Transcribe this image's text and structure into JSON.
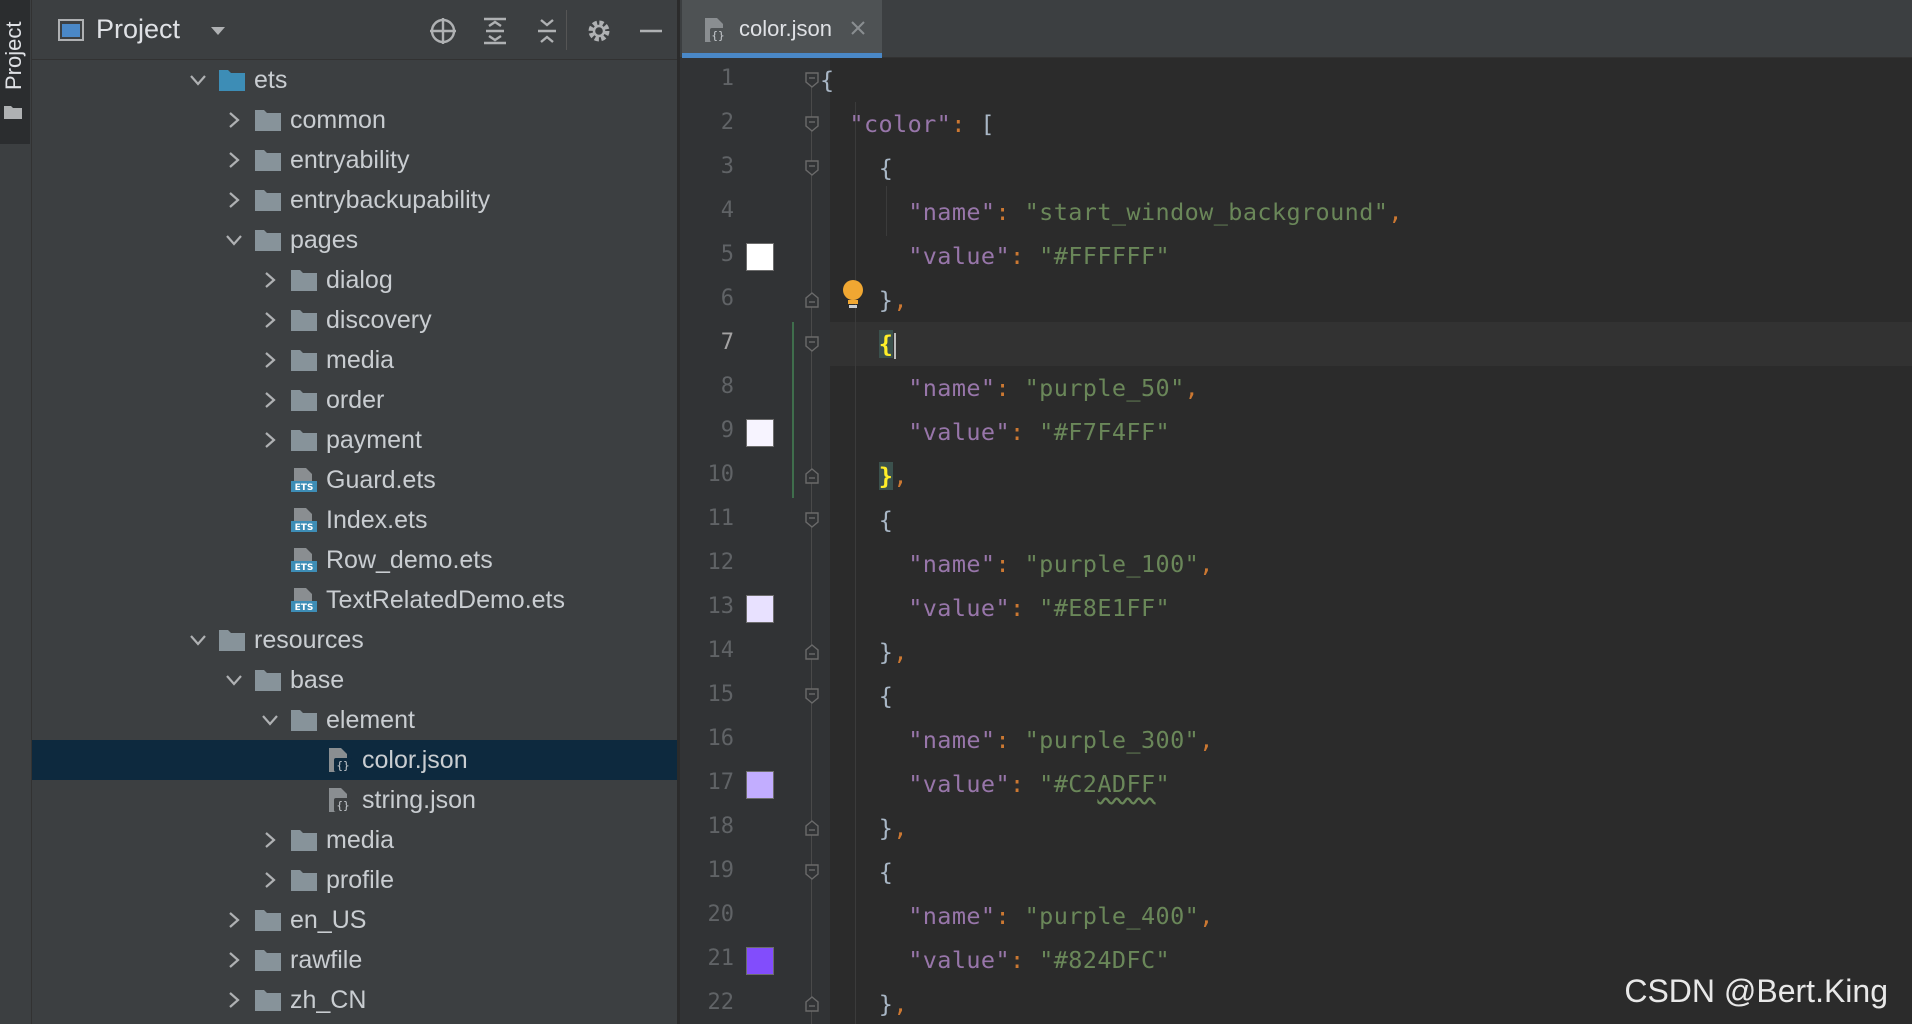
{
  "tool_stripe": {
    "project_label": "Project"
  },
  "panel": {
    "title": "Project",
    "header_icons": [
      "target-icon",
      "expand-all-icon",
      "collapse-all-icon",
      "gear-icon",
      "minimize-icon"
    ]
  },
  "tree": [
    {
      "label": "ets",
      "depth": 0,
      "expanded": true,
      "kind": "folder",
      "color": "#3d8db6"
    },
    {
      "label": "common",
      "depth": 1,
      "expanded": false,
      "kind": "folder"
    },
    {
      "label": "entryability",
      "depth": 1,
      "expanded": false,
      "kind": "folder"
    },
    {
      "label": "entrybackupability",
      "depth": 1,
      "expanded": false,
      "kind": "folder"
    },
    {
      "label": "pages",
      "depth": 1,
      "expanded": true,
      "kind": "folder"
    },
    {
      "label": "dialog",
      "depth": 2,
      "expanded": false,
      "kind": "folder"
    },
    {
      "label": "discovery",
      "depth": 2,
      "expanded": false,
      "kind": "folder"
    },
    {
      "label": "media",
      "depth": 2,
      "expanded": false,
      "kind": "folder"
    },
    {
      "label": "order",
      "depth": 2,
      "expanded": false,
      "kind": "folder"
    },
    {
      "label": "payment",
      "depth": 2,
      "expanded": false,
      "kind": "folder"
    },
    {
      "label": "Guard.ets",
      "depth": 2,
      "kind": "ets"
    },
    {
      "label": "Index.ets",
      "depth": 2,
      "kind": "ets"
    },
    {
      "label": "Row_demo.ets",
      "depth": 2,
      "kind": "ets"
    },
    {
      "label": "TextRelatedDemo.ets",
      "depth": 2,
      "kind": "ets"
    },
    {
      "label": "resources",
      "depth": 0,
      "expanded": true,
      "kind": "folder"
    },
    {
      "label": "base",
      "depth": 1,
      "expanded": true,
      "kind": "folder"
    },
    {
      "label": "element",
      "depth": 2,
      "expanded": true,
      "kind": "folder"
    },
    {
      "label": "color.json",
      "depth": 3,
      "kind": "json",
      "selected": true
    },
    {
      "label": "string.json",
      "depth": 3,
      "kind": "json"
    },
    {
      "label": "media",
      "depth": 2,
      "expanded": false,
      "kind": "folder"
    },
    {
      "label": "profile",
      "depth": 2,
      "expanded": false,
      "kind": "folder"
    },
    {
      "label": "en_US",
      "depth": 1,
      "expanded": false,
      "kind": "folder"
    },
    {
      "label": "rawfile",
      "depth": 1,
      "expanded": false,
      "kind": "folder"
    },
    {
      "label": "zh_CN",
      "depth": 1,
      "expanded": false,
      "kind": "folder"
    }
  ],
  "editor": {
    "tab": {
      "label": "color.json",
      "active": true
    },
    "current_line": 7,
    "lines": [
      {
        "n": "1"
      },
      {
        "n": "2"
      },
      {
        "n": "3"
      },
      {
        "n": "4"
      },
      {
        "n": "5",
        "swatch": "#FFFFFF"
      },
      {
        "n": "6"
      },
      {
        "n": "7"
      },
      {
        "n": "8"
      },
      {
        "n": "9",
        "swatch": "#F7F4FF"
      },
      {
        "n": "10"
      },
      {
        "n": "11"
      },
      {
        "n": "12"
      },
      {
        "n": "13",
        "swatch": "#E8E1FF"
      },
      {
        "n": "14"
      },
      {
        "n": "15"
      },
      {
        "n": "16"
      },
      {
        "n": "17",
        "swatch": "#C2ADFF"
      },
      {
        "n": "18"
      },
      {
        "n": "19"
      },
      {
        "n": "20"
      },
      {
        "n": "21",
        "swatch": "#824DFC"
      },
      {
        "n": "22"
      }
    ],
    "code": {
      "key_color": "color",
      "key_name": "name",
      "key_value": "value",
      "names": [
        "start_window_background",
        "purple_50",
        "purple_100",
        "purple_300",
        "purple_400"
      ],
      "values": [
        "#FFFFFF",
        "#F7F4FF",
        "#E8E1FF",
        "#C2ADFF",
        "#824DFC"
      ]
    }
  },
  "colors": {
    "key": "#9876aa",
    "string": "#6a8759",
    "punct": "#a9b7c6",
    "comma": "#cc7832",
    "selection": "#0d293e",
    "tab_underline": "#4a88c7"
  },
  "watermark": "CSDN @Bert.King"
}
